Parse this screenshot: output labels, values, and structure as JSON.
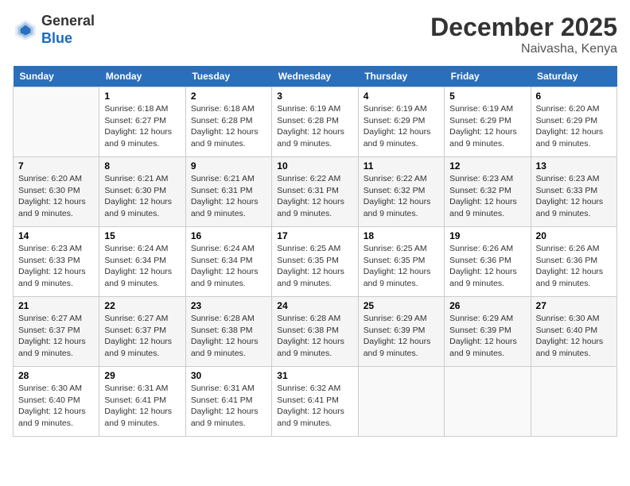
{
  "logo": {
    "line1": "General",
    "line2": "Blue"
  },
  "title": "December 2025",
  "location": "Naivasha, Kenya",
  "weekdays": [
    "Sunday",
    "Monday",
    "Tuesday",
    "Wednesday",
    "Thursday",
    "Friday",
    "Saturday"
  ],
  "weeks": [
    [
      {
        "day": "",
        "info": ""
      },
      {
        "day": "1",
        "info": "Sunrise: 6:18 AM\nSunset: 6:27 PM\nDaylight: 12 hours\nand 9 minutes."
      },
      {
        "day": "2",
        "info": "Sunrise: 6:18 AM\nSunset: 6:28 PM\nDaylight: 12 hours\nand 9 minutes."
      },
      {
        "day": "3",
        "info": "Sunrise: 6:19 AM\nSunset: 6:28 PM\nDaylight: 12 hours\nand 9 minutes."
      },
      {
        "day": "4",
        "info": "Sunrise: 6:19 AM\nSunset: 6:29 PM\nDaylight: 12 hours\nand 9 minutes."
      },
      {
        "day": "5",
        "info": "Sunrise: 6:19 AM\nSunset: 6:29 PM\nDaylight: 12 hours\nand 9 minutes."
      },
      {
        "day": "6",
        "info": "Sunrise: 6:20 AM\nSunset: 6:29 PM\nDaylight: 12 hours\nand 9 minutes."
      }
    ],
    [
      {
        "day": "7",
        "info": "Sunrise: 6:20 AM\nSunset: 6:30 PM\nDaylight: 12 hours\nand 9 minutes."
      },
      {
        "day": "8",
        "info": "Sunrise: 6:21 AM\nSunset: 6:30 PM\nDaylight: 12 hours\nand 9 minutes."
      },
      {
        "day": "9",
        "info": "Sunrise: 6:21 AM\nSunset: 6:31 PM\nDaylight: 12 hours\nand 9 minutes."
      },
      {
        "day": "10",
        "info": "Sunrise: 6:22 AM\nSunset: 6:31 PM\nDaylight: 12 hours\nand 9 minutes."
      },
      {
        "day": "11",
        "info": "Sunrise: 6:22 AM\nSunset: 6:32 PM\nDaylight: 12 hours\nand 9 minutes."
      },
      {
        "day": "12",
        "info": "Sunrise: 6:23 AM\nSunset: 6:32 PM\nDaylight: 12 hours\nand 9 minutes."
      },
      {
        "day": "13",
        "info": "Sunrise: 6:23 AM\nSunset: 6:33 PM\nDaylight: 12 hours\nand 9 minutes."
      }
    ],
    [
      {
        "day": "14",
        "info": "Sunrise: 6:23 AM\nSunset: 6:33 PM\nDaylight: 12 hours\nand 9 minutes."
      },
      {
        "day": "15",
        "info": "Sunrise: 6:24 AM\nSunset: 6:34 PM\nDaylight: 12 hours\nand 9 minutes."
      },
      {
        "day": "16",
        "info": "Sunrise: 6:24 AM\nSunset: 6:34 PM\nDaylight: 12 hours\nand 9 minutes."
      },
      {
        "day": "17",
        "info": "Sunrise: 6:25 AM\nSunset: 6:35 PM\nDaylight: 12 hours\nand 9 minutes."
      },
      {
        "day": "18",
        "info": "Sunrise: 6:25 AM\nSunset: 6:35 PM\nDaylight: 12 hours\nand 9 minutes."
      },
      {
        "day": "19",
        "info": "Sunrise: 6:26 AM\nSunset: 6:36 PM\nDaylight: 12 hours\nand 9 minutes."
      },
      {
        "day": "20",
        "info": "Sunrise: 6:26 AM\nSunset: 6:36 PM\nDaylight: 12 hours\nand 9 minutes."
      }
    ],
    [
      {
        "day": "21",
        "info": "Sunrise: 6:27 AM\nSunset: 6:37 PM\nDaylight: 12 hours\nand 9 minutes."
      },
      {
        "day": "22",
        "info": "Sunrise: 6:27 AM\nSunset: 6:37 PM\nDaylight: 12 hours\nand 9 minutes."
      },
      {
        "day": "23",
        "info": "Sunrise: 6:28 AM\nSunset: 6:38 PM\nDaylight: 12 hours\nand 9 minutes."
      },
      {
        "day": "24",
        "info": "Sunrise: 6:28 AM\nSunset: 6:38 PM\nDaylight: 12 hours\nand 9 minutes."
      },
      {
        "day": "25",
        "info": "Sunrise: 6:29 AM\nSunset: 6:39 PM\nDaylight: 12 hours\nand 9 minutes."
      },
      {
        "day": "26",
        "info": "Sunrise: 6:29 AM\nSunset: 6:39 PM\nDaylight: 12 hours\nand 9 minutes."
      },
      {
        "day": "27",
        "info": "Sunrise: 6:30 AM\nSunset: 6:40 PM\nDaylight: 12 hours\nand 9 minutes."
      }
    ],
    [
      {
        "day": "28",
        "info": "Sunrise: 6:30 AM\nSunset: 6:40 PM\nDaylight: 12 hours\nand 9 minutes."
      },
      {
        "day": "29",
        "info": "Sunrise: 6:31 AM\nSunset: 6:41 PM\nDaylight: 12 hours\nand 9 minutes."
      },
      {
        "day": "30",
        "info": "Sunrise: 6:31 AM\nSunset: 6:41 PM\nDaylight: 12 hours\nand 9 minutes."
      },
      {
        "day": "31",
        "info": "Sunrise: 6:32 AM\nSunset: 6:41 PM\nDaylight: 12 hours\nand 9 minutes."
      },
      {
        "day": "",
        "info": ""
      },
      {
        "day": "",
        "info": ""
      },
      {
        "day": "",
        "info": ""
      }
    ]
  ]
}
